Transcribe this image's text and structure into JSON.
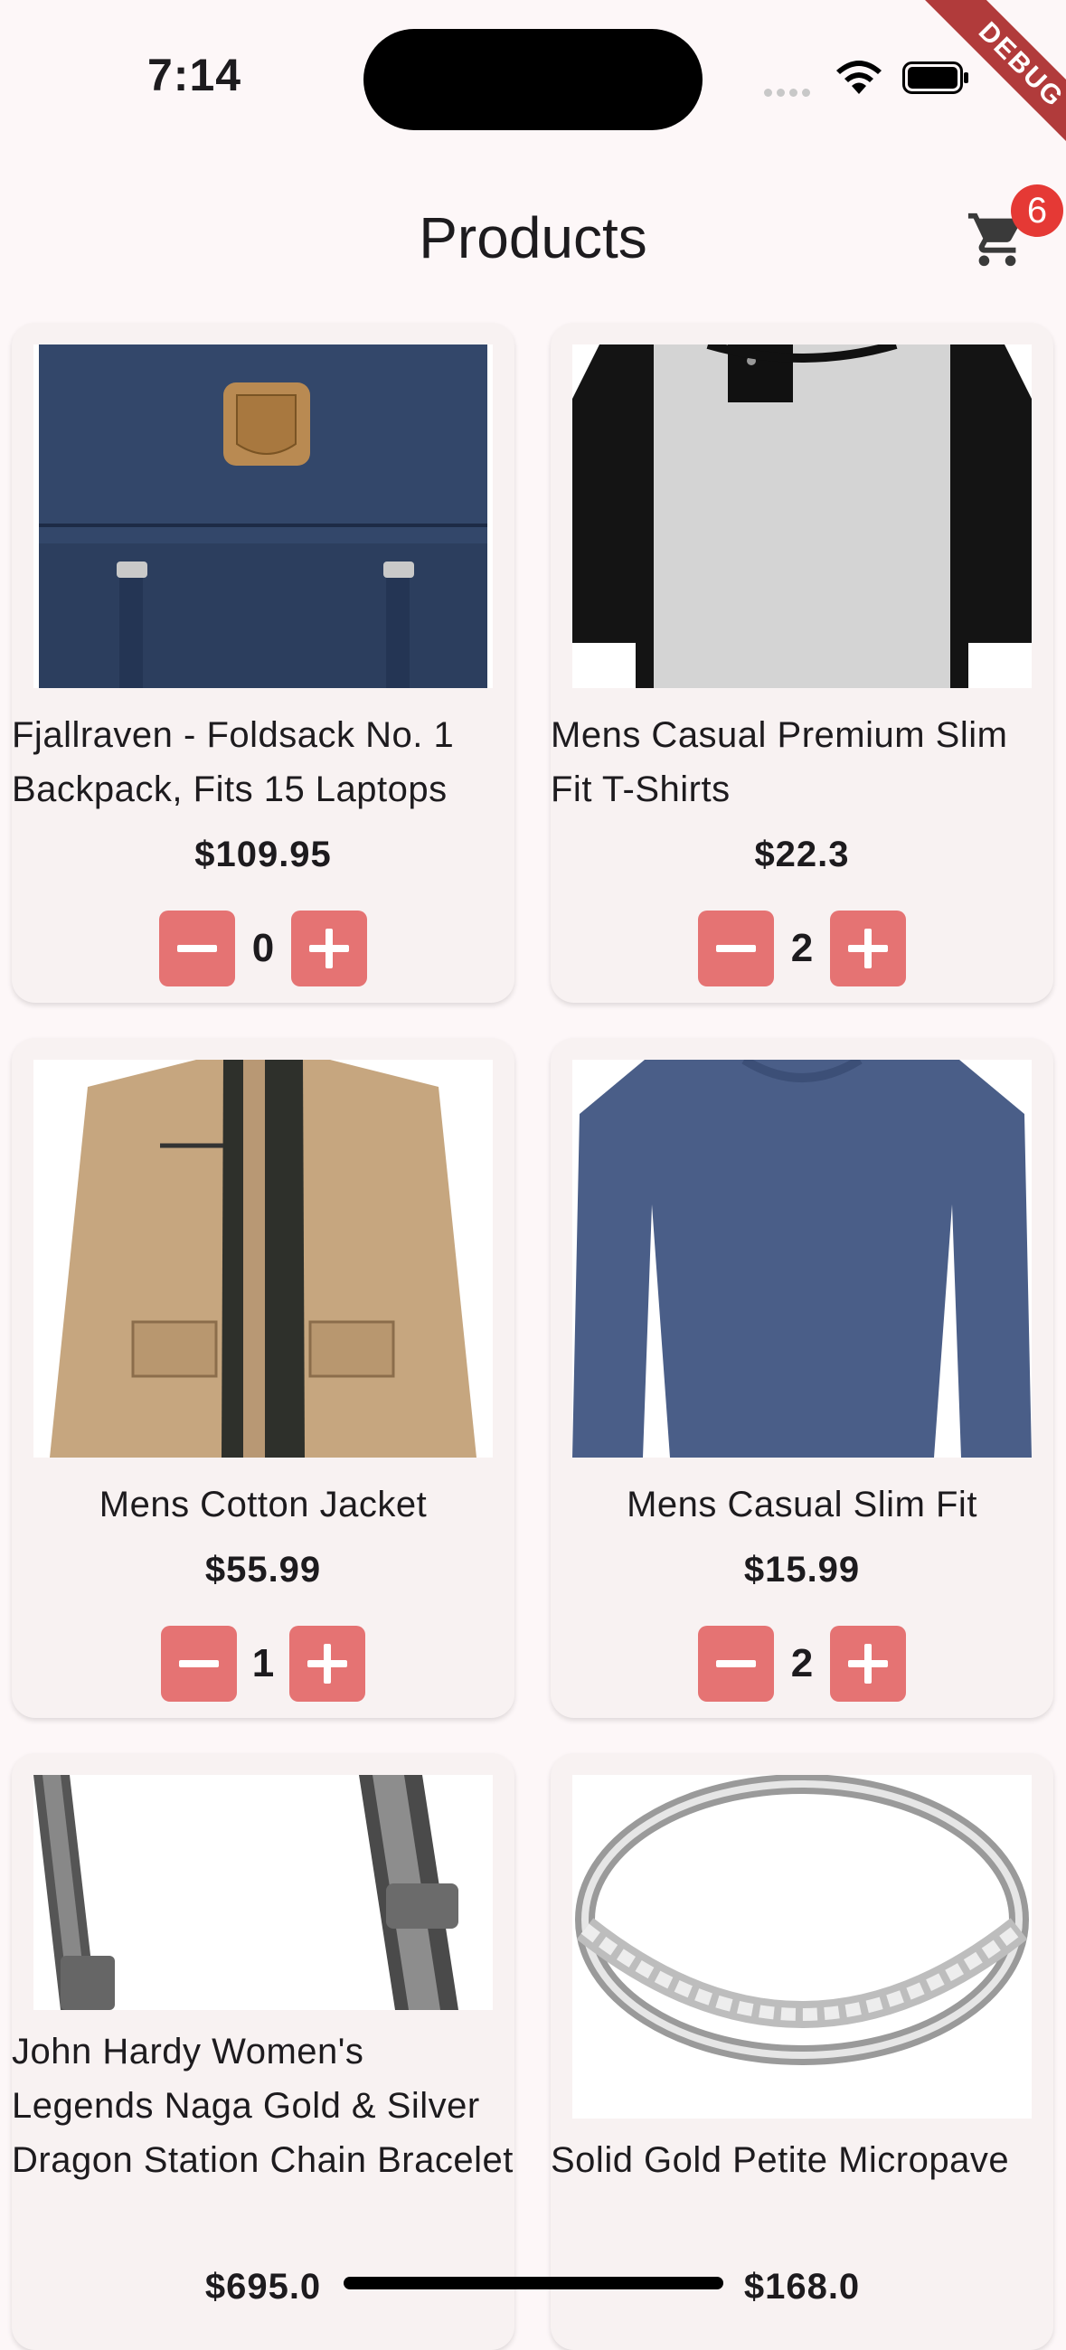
{
  "status": {
    "time": "7:14"
  },
  "debug_label": "DEBUG",
  "appbar": {
    "title": "Products",
    "cart_count": "6"
  },
  "products": [
    {
      "title": "Fjallraven - Foldsack No. 1 Backpack, Fits 15 Laptops",
      "price": "$109.95",
      "qty": "0"
    },
    {
      "title": "Mens Casual Premium Slim Fit T-Shirts",
      "price": "$22.3",
      "qty": "2"
    },
    {
      "title": "Mens Cotton Jacket",
      "price": "$55.99",
      "qty": "1"
    },
    {
      "title": "Mens Casual Slim Fit",
      "price": "$15.99",
      "qty": "2"
    },
    {
      "title": "John Hardy Women's Legends Naga Gold & Silver Dragon Station Chain Bracelet",
      "price": "$695.0"
    },
    {
      "title": "Solid Gold Petite Micropave",
      "price": "$168.0"
    }
  ],
  "colors": {
    "accent": "#e57373",
    "badge": "#e53935",
    "background": "#fdf7f8",
    "card": "#f8f2f2"
  }
}
